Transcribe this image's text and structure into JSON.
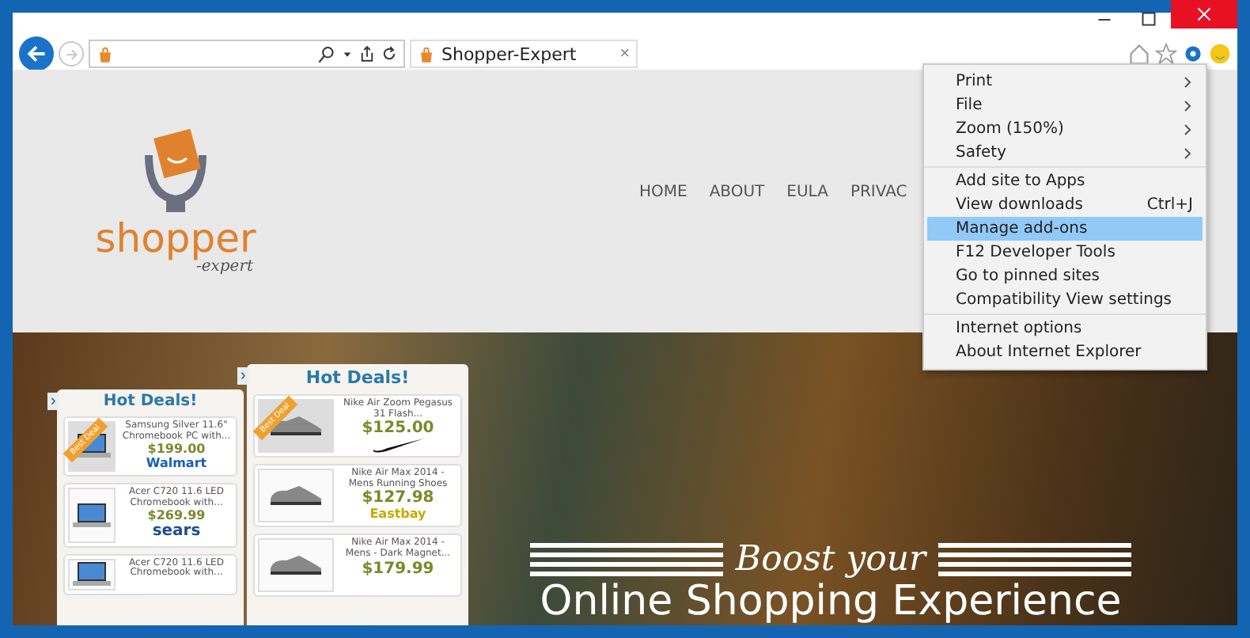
{
  "tab": {
    "title": "Shopper-Expert",
    "close": "×"
  },
  "site": {
    "logo": {
      "name": "shopper",
      "tagline": "-expert"
    },
    "nav": [
      {
        "label": "HOME"
      },
      {
        "label": "ABOUT"
      },
      {
        "label": "EULA"
      },
      {
        "label": "PRIVAC"
      }
    ],
    "hero": {
      "script_line": "Boost your",
      "headline": "Online Shopping Experience"
    },
    "widgets": [
      {
        "title": "Hot Deals!",
        "collapse": "›",
        "deals": [
          {
            "badge": "Best Deal",
            "name": "Samsung Silver 11.6\" Chromebook PC with...",
            "price": "$199.00",
            "store": {
              "kind": "wordmark",
              "text": "Walmart",
              "color": "#1a5fb4"
            }
          },
          {
            "name": "Acer C720 11.6 LED Chromebook with...",
            "price": "$269.99",
            "store": {
              "kind": "wordmark",
              "text": "sears",
              "color": "#1d4f91"
            }
          },
          {
            "name": "Acer C720 11.6 LED Chromebook with..."
          }
        ]
      },
      {
        "title": "Hot Deals!",
        "collapse": "›",
        "deals": [
          {
            "badge": "Best Deal",
            "name": "Nike Air Zoom Pegasus 31 Flash...",
            "price": "$125.00",
            "store": {
              "kind": "swoosh"
            }
          },
          {
            "name": "Nike Air Max 2014 - Mens Running Shoes",
            "price": "$127.98",
            "store": {
              "kind": "wordmark",
              "text": "Eastbay",
              "color": "#c9a800"
            }
          },
          {
            "name": "Nike Air Max 2014 - Mens - Dark Magnet...",
            "price": "$179.99"
          }
        ]
      }
    ]
  },
  "menu": {
    "groups": [
      [
        {
          "label": "Print",
          "submenu": true,
          "selected": false
        },
        {
          "label": "File",
          "submenu": true,
          "selected": false
        },
        {
          "label": "Zoom (150%)",
          "submenu": true,
          "selected": false
        },
        {
          "label": "Safety",
          "submenu": true,
          "selected": false
        }
      ],
      [
        {
          "label": "Add site to Apps",
          "submenu": false,
          "selected": false
        },
        {
          "label": "View downloads",
          "shortcut": "Ctrl+J",
          "submenu": false,
          "selected": false
        },
        {
          "label": "Manage add-ons",
          "submenu": false,
          "selected": true
        },
        {
          "label": "F12 Developer Tools",
          "submenu": false,
          "selected": false
        },
        {
          "label": "Go to pinned sites",
          "submenu": false,
          "selected": false
        },
        {
          "label": "Compatibility View settings",
          "submenu": false,
          "selected": false
        }
      ],
      [
        {
          "label": "Internet options",
          "submenu": false,
          "selected": false
        },
        {
          "label": "About Internet Explorer",
          "submenu": false,
          "selected": false
        }
      ]
    ]
  }
}
